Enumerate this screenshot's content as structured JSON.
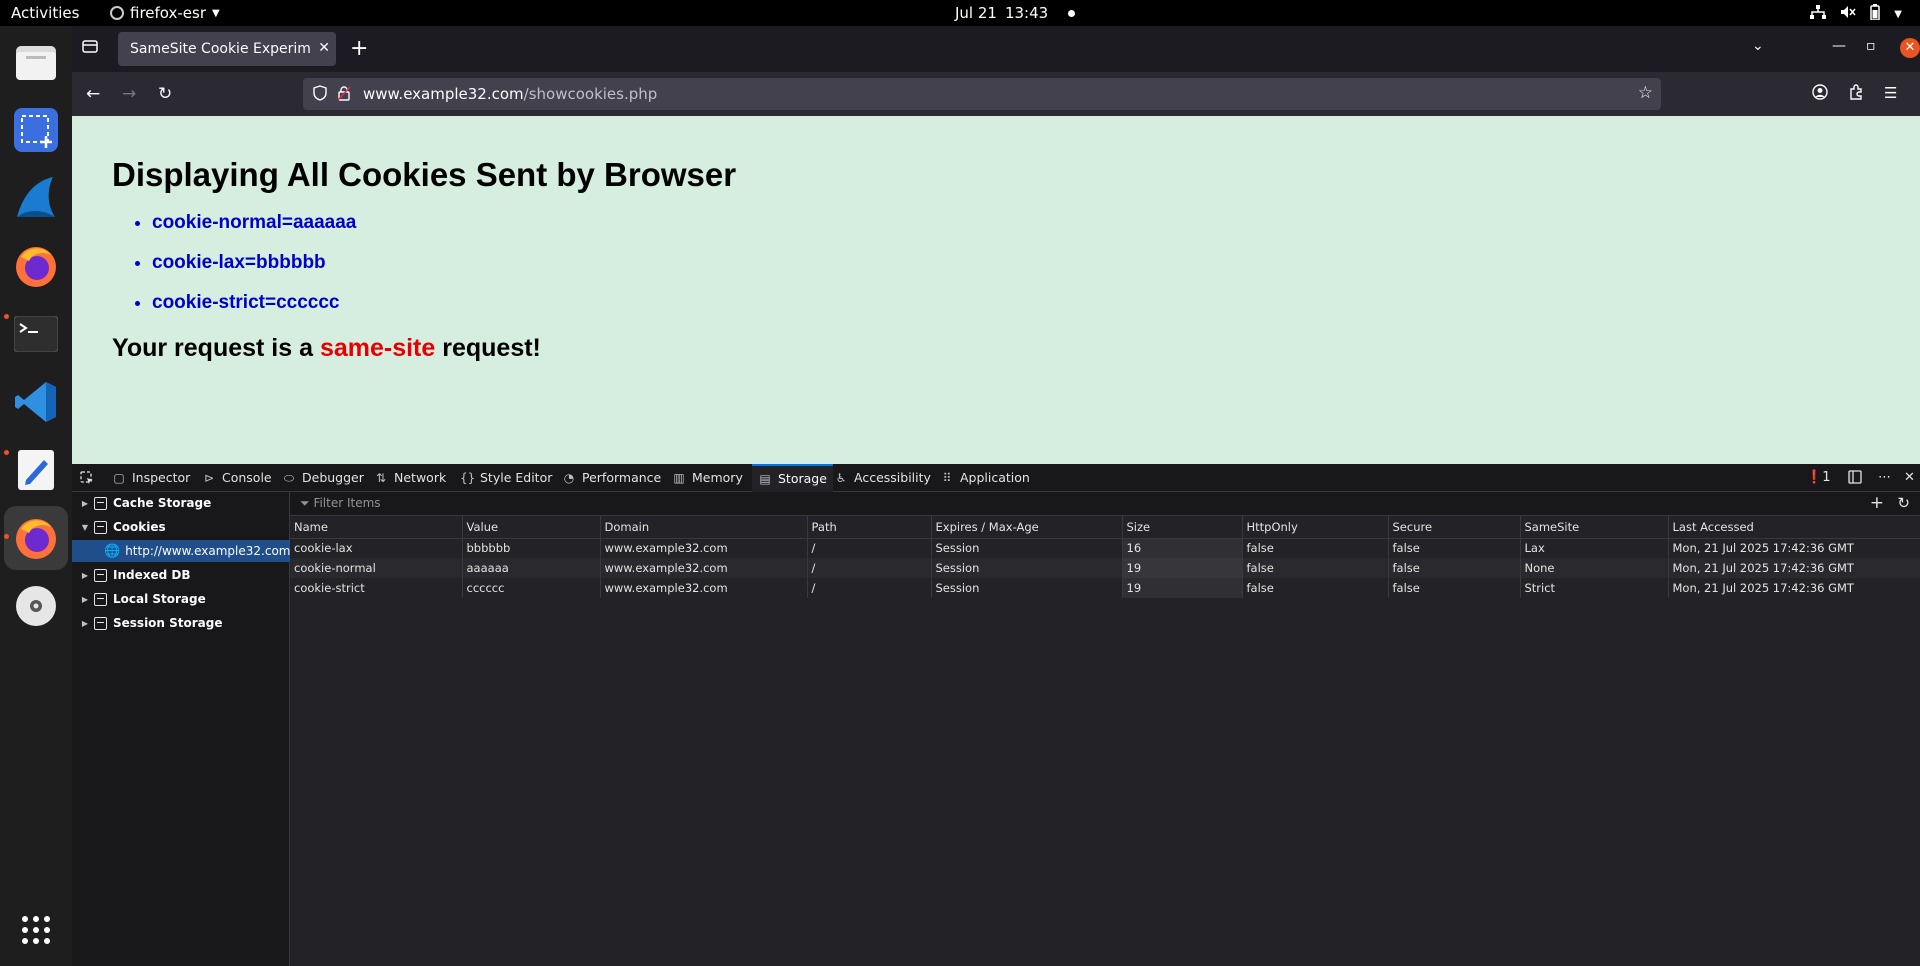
{
  "system": {
    "activities": "Activities",
    "app_name": "firefox-esr",
    "date": "Jul 21",
    "time": "13:43"
  },
  "browser": {
    "tab_title": "SameSite Cookie Experiment",
    "url_host": "www.example32.com",
    "url_path": "/showcookies.php"
  },
  "page": {
    "heading": "Displaying All Cookies Sent by Browser",
    "cookies": [
      "cookie-normal=aaaaaa",
      "cookie-lax=bbbbbb",
      "cookie-strict=cccccc"
    ],
    "verdict_prefix": "Your request is a ",
    "verdict_highlight": "same-site",
    "verdict_suffix": " request!"
  },
  "devtools": {
    "tabs": [
      "Inspector",
      "Console",
      "Debugger",
      "Network",
      "Style Editor",
      "Performance",
      "Memory",
      "Storage",
      "Accessibility",
      "Application"
    ],
    "selected_tab": "Storage",
    "error_count": "1",
    "sidebar": {
      "cache_storage": "Cache Storage",
      "cookies": "Cookies",
      "host": "http://www.example32.com",
      "indexed_db": "Indexed DB",
      "local_storage": "Local Storage",
      "session_storage": "Session Storage"
    },
    "filter_placeholder": "Filter Items",
    "columns": [
      "Name",
      "Value",
      "Domain",
      "Path",
      "Expires / Max-Age",
      "Size",
      "HttpOnly",
      "Secure",
      "SameSite",
      "Last Accessed"
    ],
    "rows": [
      [
        "cookie-lax",
        "bbbbbb",
        "www.example32.com",
        "/",
        "Session",
        "16",
        "false",
        "false",
        "Lax",
        "Mon, 21 Jul 2025 17:42:36 GMT"
      ],
      [
        "cookie-normal",
        "aaaaaa",
        "www.example32.com",
        "/",
        "Session",
        "19",
        "false",
        "false",
        "None",
        "Mon, 21 Jul 2025 17:42:36 GMT"
      ],
      [
        "cookie-strict",
        "cccccc",
        "www.example32.com",
        "/",
        "Session",
        "19",
        "false",
        "false",
        "Strict",
        "Mon, 21 Jul 2025 17:42:36 GMT"
      ]
    ]
  },
  "colors": {
    "page_bg": "#d5eee0",
    "cookie_text": "#0000cc",
    "highlight_red": "#e60000",
    "selected_host": "#204e8a",
    "accent_orange": "#e95420"
  }
}
